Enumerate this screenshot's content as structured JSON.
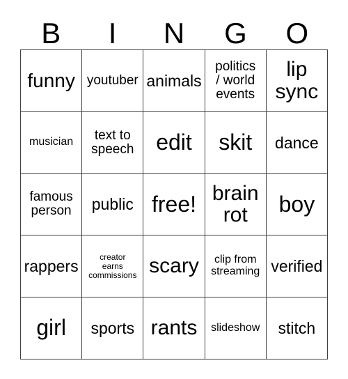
{
  "card": {
    "header_letters": [
      "B",
      "I",
      "N",
      "G",
      "O"
    ],
    "columns": 5,
    "rows": 5,
    "border_color": "#3f3f3f",
    "background_color": "#ffffff",
    "text_color": "#000000",
    "free_space": "free!",
    "cells": [
      [
        {
          "label": "funny",
          "size": "lg"
        },
        {
          "label": "youtuber",
          "size": "sm"
        },
        {
          "label": "animals",
          "size": "md"
        },
        {
          "label": "politics\n/ world\nevents",
          "size": "sm"
        },
        {
          "label": "lip\nsync",
          "size": "xl"
        }
      ],
      [
        {
          "label": "musician",
          "size": "xs"
        },
        {
          "label": "text to\nspeech",
          "size": "sm"
        },
        {
          "label": "edit",
          "size": "xxl"
        },
        {
          "label": "skit",
          "size": "xxl"
        },
        {
          "label": "dance",
          "size": "md"
        }
      ],
      [
        {
          "label": "famous\nperson",
          "size": "sm"
        },
        {
          "label": "public",
          "size": "md"
        },
        {
          "label": "free!",
          "size": "xxl"
        },
        {
          "label": "brain\nrot",
          "size": "xl"
        },
        {
          "label": "boy",
          "size": "xxl"
        }
      ],
      [
        {
          "label": "rappers",
          "size": "md"
        },
        {
          "label": "creator\nearns\ncommissions",
          "size": "xxs"
        },
        {
          "label": "scary",
          "size": "xl"
        },
        {
          "label": "clip from\nstreaming",
          "size": "xs"
        },
        {
          "label": "verified",
          "size": "md"
        }
      ],
      [
        {
          "label": "girl",
          "size": "xxl"
        },
        {
          "label": "sports",
          "size": "md"
        },
        {
          "label": "rants",
          "size": "xl"
        },
        {
          "label": "slideshow",
          "size": "xs"
        },
        {
          "label": "stitch",
          "size": "md"
        }
      ]
    ]
  }
}
